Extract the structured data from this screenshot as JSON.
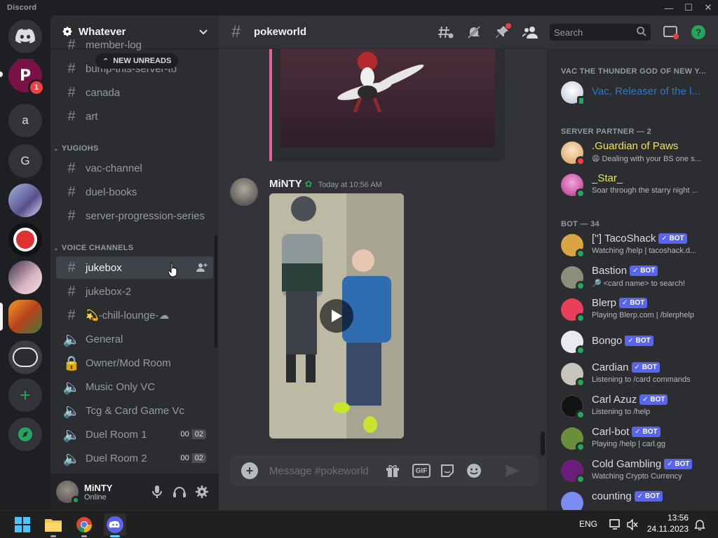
{
  "window": {
    "title": "Discord"
  },
  "servers": [
    {
      "name": "Home",
      "icon": "discord-logo-icon"
    },
    {
      "name": "P",
      "badge": "1"
    },
    {
      "name": "a"
    },
    {
      "name": "G"
    },
    {
      "name": "server-anime"
    },
    {
      "name": "server-red"
    },
    {
      "name": "server-anime-2"
    },
    {
      "name": "server-fire"
    },
    {
      "name": "server-panda"
    },
    {
      "name": "Add a Server",
      "icon": "plus-icon"
    },
    {
      "name": "Explore",
      "icon": "compass-icon"
    }
  ],
  "guild": {
    "name": "Whatever"
  },
  "new_unreads": "NEW UNREADS",
  "channels": [
    {
      "label": "bump-this-server-to",
      "kind": "text"
    },
    {
      "label": "canada",
      "kind": "text"
    },
    {
      "label": "art",
      "kind": "text"
    }
  ],
  "categories": {
    "yugiohs": "YUGIOHS",
    "voice": "VOICE CHANNELS"
  },
  "yugioh_channels": [
    {
      "label": "vac-channel"
    },
    {
      "label": "duel-books"
    },
    {
      "label": "server-progression-series"
    }
  ],
  "voice_channels": [
    {
      "label": "jukebox",
      "kind": "text"
    },
    {
      "label": "jukebox-2",
      "kind": "text"
    },
    {
      "label": "💫-chill-lounge-☁",
      "kind": "text"
    },
    {
      "label": "General",
      "kind": "voice"
    },
    {
      "label": "Owner/Mod Room",
      "kind": "locked"
    },
    {
      "label": "Music Only VC",
      "kind": "voice"
    },
    {
      "label": "Tcg & Card Game Vc",
      "kind": "voice"
    },
    {
      "label": "Duel Room 1",
      "kind": "voice",
      "count": [
        "00",
        "02"
      ]
    },
    {
      "label": "Duel Room 2",
      "kind": "voice",
      "count": [
        "00",
        "02"
      ]
    }
  ],
  "user": {
    "name": "MiNTY",
    "status": "Online"
  },
  "header": {
    "channel": "pokeworld",
    "search_placeholder": "Search"
  },
  "message": {
    "author": "MiNTY",
    "timestamp": "Today at 10:56 AM"
  },
  "composer": {
    "placeholder": "Message #pokeworld",
    "gif": "GIF"
  },
  "members": {
    "cat_vac": "VAC THE THUNDER GOD OF NEW Y...",
    "vac_member": {
      "name": "Vac, Releaser of the l..."
    },
    "cat_partner": "SERVER PARTNER — 2",
    "partners": [
      {
        "name": ".Guardian of Paws",
        "status": "😩 Dealing with your BS one s...",
        "color": "#f0e35f",
        "dot": "#f23f42"
      },
      {
        "name": "_Star_",
        "status": "Soar through the starry night ...",
        "color": "#f0e35f",
        "dot": "#23a55a"
      }
    ],
    "cat_bot": "BOT — 34",
    "bot_label": "✓ BOT",
    "bots": [
      {
        "name": "[''] TacoShack",
        "status": "Watching /help | tacoshack.d...",
        "av": "#d9a441"
      },
      {
        "name": "Bastion",
        "status": "🔎 <card name> to search!",
        "av": "#8a8f7a"
      },
      {
        "name": "Blerp",
        "status": "Playing Blerp.com | /blerphelp",
        "av": "#e83f5b"
      },
      {
        "name": "Bongo",
        "status": "",
        "av": "#e8eaee"
      },
      {
        "name": "Cardian",
        "status": "Listening to /card commands",
        "av": "#c7c5bb"
      },
      {
        "name": "Carl Azuz",
        "status": "Listening to /help",
        "av": "#111214"
      },
      {
        "name": "Carl-bot",
        "status": "Playing /help | carl.gg",
        "av": "#6b8e3a"
      },
      {
        "name": "Cold Gambling",
        "status": "Watching Crypto Currency",
        "av": "#6a1e7a"
      },
      {
        "name": "counting",
        "status": "",
        "av": "#7b8cf0"
      }
    ]
  },
  "taskbar": {
    "lang": "ENG",
    "time": "13:56",
    "date": "24.11.2023"
  }
}
